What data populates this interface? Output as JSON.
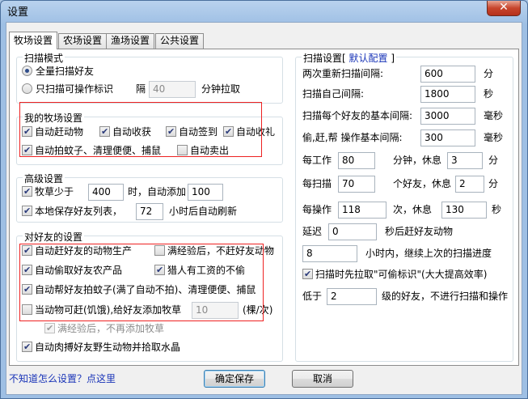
{
  "window": {
    "title": "设置",
    "close_glyph": "✕"
  },
  "tabs": [
    {
      "label": "牧场设置"
    },
    {
      "label": "农场设置"
    },
    {
      "label": "渔场设置"
    },
    {
      "label": "公共设置"
    }
  ],
  "scan_mode": {
    "title": "扫描模式",
    "opt_all": "全量扫描好友",
    "opt_marked": "只扫描可操作标识",
    "interval_label": "隔",
    "interval_value": "40",
    "interval_unit": "分钟拉取"
  },
  "my_ranch": {
    "title": "我的牧场设置",
    "auto_drive": "自动赶动物",
    "auto_harvest": "自动收获",
    "auto_signin": "自动签到",
    "auto_gift": "自动收礼",
    "auto_clean": "自动拍蚊子、清理便便、捕鼠",
    "auto_sell": "自动卖出"
  },
  "advanced": {
    "title": "高级设置",
    "grass_prefix": "牧草少于",
    "grass_value": "400",
    "grass_mid": "时，自动添加",
    "grass_add": "100",
    "save_list": "本地保存好友列表，",
    "refresh_value": "72",
    "refresh_unit": "小时后自动刷新"
  },
  "friends": {
    "title": "对好友的设置",
    "drive_animals": "自动赶好友的动物生产",
    "exp_full_no_drive": "满经验后，不赶好友动物",
    "steal_products": "自动偷取好友农产品",
    "no_steal_paid": "猎人有工资的不偷",
    "help_clean": "自动帮好友拍蚊子(满了自动不拍)、清理便便、捕鼠",
    "hungry_prefix": "当动物可赶(饥饿),给好友添加牧草",
    "hungry_value": "10",
    "hungry_unit": "(棵/次)",
    "exp_full_no_add": "满经验后，不再添加牧草",
    "catch_wild": "自动肉搏好友野生动物并拾取水晶"
  },
  "scan_settings": {
    "title_prefix": "扫描设置[",
    "default_link": "默认配置",
    "title_suffix": "]",
    "rescan_label": "两次重新扫描间隔:",
    "rescan_value": "600",
    "rescan_unit": "分",
    "self_label": "扫描自己间隔:",
    "self_value": "1800",
    "self_unit": "秒",
    "friend_label": "扫描每个好友的基本间隔:",
    "friend_value": "3000",
    "friend_unit": "毫秒",
    "op_label": "偷,赶,帮 操作基本间隔:",
    "op_value": "300",
    "op_unit": "毫秒",
    "work_prefix": "每工作",
    "work_value": "80",
    "work_mid": "分钟，休息",
    "work_rest": "3",
    "work_unit": "分",
    "scan_prefix": "每扫描",
    "scan_value": "70",
    "scan_mid": "个好友，休息",
    "scan_rest": "2",
    "scan_unit": "分",
    "oper_prefix": "每操作",
    "oper_value": "118",
    "oper_mid": "次，休息",
    "oper_rest": "130",
    "oper_unit": "秒",
    "delay_prefix": "延迟",
    "delay_value": "0",
    "delay_unit": "秒后赶好友动物",
    "continue_value": "8",
    "continue_unit": "小时内，继续上次的扫描进度",
    "prefetch": "扫描时先拉取\"可偷标识\"(大大提高效率)",
    "level_prefix": "低于",
    "level_value": "2",
    "level_unit": "级的好友，不进行扫描和操作"
  },
  "footer": {
    "help_link": "不知道怎么设置？点这里",
    "ok": "确定保存",
    "cancel": "取消"
  }
}
